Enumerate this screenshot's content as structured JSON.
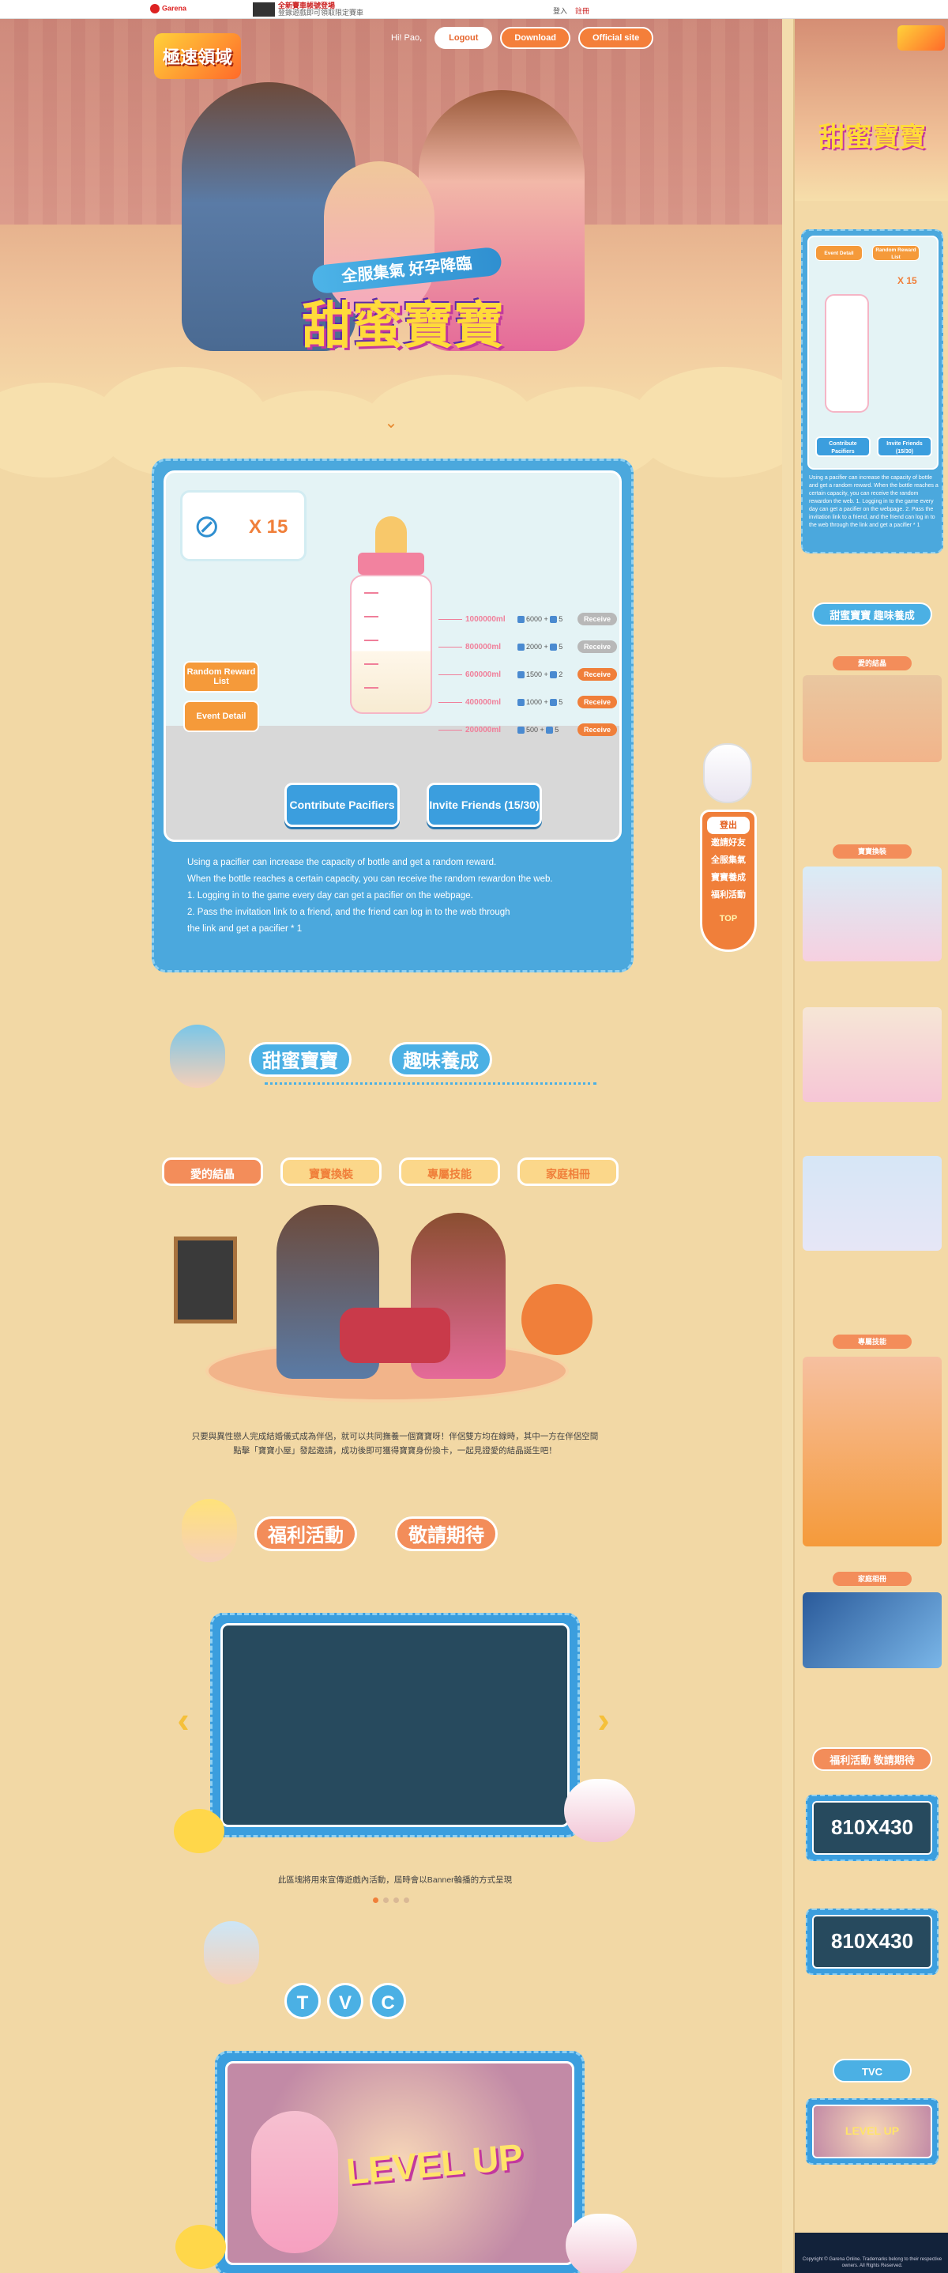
{
  "topbar": {
    "brand": "Garena",
    "promo_title": "全新賽車帳號登場",
    "promo_sub": "登錄遊戲即可領取限定賽車",
    "links": [
      "登入",
      "註冊"
    ]
  },
  "hero": {
    "game_logo": "極速領域",
    "greeting": "Hi! Pao,",
    "logout": "Logout",
    "download": "Download",
    "official": "Official site",
    "banner": "全服集氣 好孕降臨",
    "title": "甜蜜寶寶",
    "scroll_icon": "chevron-down-icon"
  },
  "event": {
    "pacifier_count": "X 15",
    "levels": [
      {
        "ml": "1000000ml",
        "reward": "6000 + ",
        "qty": "5",
        "btn": "Receive",
        "state": "off"
      },
      {
        "ml": "800000ml",
        "reward": "2000 + ",
        "qty": "5",
        "btn": "Receive",
        "state": "off"
      },
      {
        "ml": "600000ml",
        "reward": "1500 + ",
        "qty": "2",
        "btn": "Receive",
        "state": "on"
      },
      {
        "ml": "400000ml",
        "reward": "1000 + ",
        "qty": "5",
        "btn": "Receive",
        "state": "on"
      },
      {
        "ml": "200000ml",
        "reward": "500 + ",
        "qty": "5",
        "btn": "Receive",
        "state": "on"
      }
    ],
    "random_reward": "Random Reward List",
    "event_detail": "Event Detail",
    "contribute": "Contribute Pacifiers",
    "invite": "Invite Friends (15/30)",
    "rules": [
      "Using a pacifier can increase the capacity of bottle and get a random reward.",
      "When the bottle reaches a certain capacity, you can receive the random rewardon the web.",
      "1. Logging in to the game every day can get a pacifier on the webpage.",
      "2. Pass the invitation link to a friend, and the friend can log in to the web through",
      "the link and get a pacifier * 1"
    ]
  },
  "sidefloat": {
    "items": [
      "登出",
      "邀請好友",
      "全服集氣",
      "寶寶養成",
      "福利活動"
    ],
    "top": "TOP"
  },
  "section2": {
    "title_a": "甜蜜寶寶",
    "title_b": "趣味養成",
    "tabs": [
      "愛的結晶",
      "寶寶換裝",
      "專屬技能",
      "家庭相冊"
    ],
    "desc": "只要與異性戀人完成結婚儀式成為伴侶，就可以共同撫養一個寶寶呀！伴侶雙方均在線時，其中一方在伴侶空間點擊「寶寶小屋」發起邀請，成功後即可獲得寶寶身份換卡，一起見證愛的結晶誕生吧！"
  },
  "section3": {
    "title_a": "福利活動",
    "title_b": "敬請期待",
    "caption": "此區塊將用來宣傳遊戲內活動，屆時會以Banner輪播的方式呈現",
    "prev": "‹",
    "next": "›"
  },
  "tvc": {
    "letters": [
      "T",
      "V",
      "C"
    ],
    "screen_text": "LEVEL UP"
  },
  "mobile": {
    "event_detail": "Event Detail",
    "random_reward": "Random Reward List",
    "count": "X 15",
    "contribute": "Contribute Pacifiers",
    "invite": "Invite Friends (15/30)",
    "rules": "Using a pacifier can increase the capacity of bottle and get a random reward. When the bottle reaches a certain capacity, you can receive the random rewardon the web. 1. Logging in to the game every day can get a pacifier on the webpage. 2. Pass the invitation link to a friend, and the friend can log in to the web through the link and get a pacifier * 1",
    "title_a": "甜蜜寶寶 趣味養成",
    "sub1": "愛的結晶",
    "sub2": "寶寶換裝",
    "sub3": "專屬技能",
    "sub4": "家庭相冊",
    "title_b": "福利活動 敬請期待",
    "banner_text": "810X430",
    "tvc": "TVC",
    "footer": "Copyright © Garena Online. Trademarks belong to their respective owners. All Rights Reserved."
  }
}
